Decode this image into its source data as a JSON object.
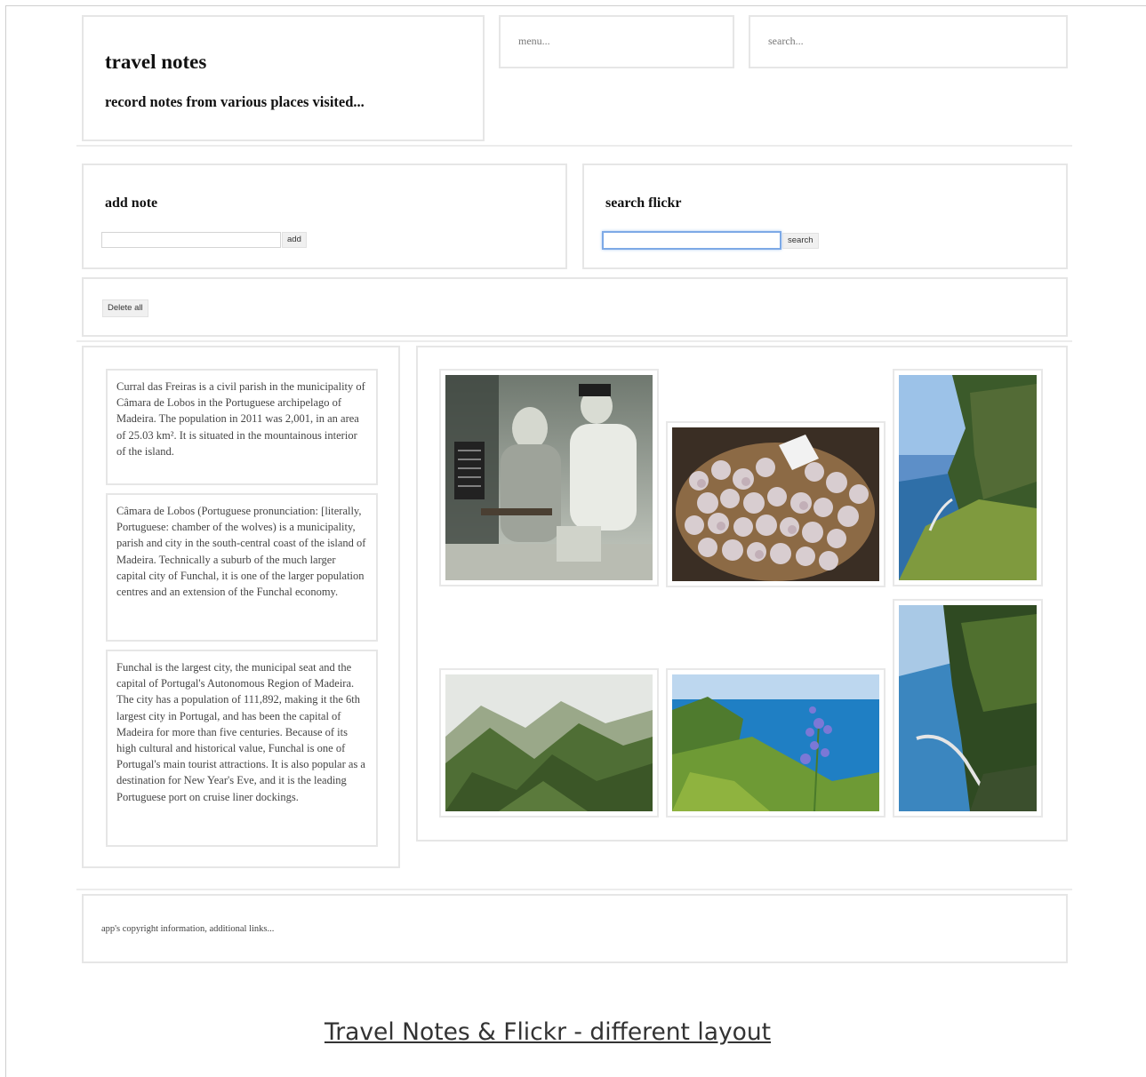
{
  "header": {
    "title": "travel notes",
    "tagline": "record notes from various places visited...",
    "menu_placeholder": "menu...",
    "search_placeholder": "search..."
  },
  "add_note": {
    "title": "add note",
    "input_value": "",
    "button_label": "add"
  },
  "search_flickr": {
    "title": "search flickr",
    "input_value": "",
    "button_label": "search"
  },
  "controls": {
    "delete_all_label": "Delete all"
  },
  "notes": [
    "Curral das Freiras is a civil parish in the municipality of Câmara de Lobos in the Portuguese archipelago of Madeira. The population in 2011 was 2,001, in an area of 25.03 km². It is situated in the mountainous interior of the island.",
    "Câmara de Lobos (Portuguese pronunciation: [literally, Portuguese: chamber of the wolves) is a municipality, parish and city in the south-central coast of the island of Madeira. Technically a suburb of the much larger capital city of Funchal, it is one of the larger population centres and an extension of the Funchal economy.",
    "Funchal is the largest city, the municipal seat and the capital of Portugal's Autonomous Region of Madeira. The city has a population of 111,892, making it the 6th largest city in Portugal, and has been the capital of Madeira for more than five centuries. Because of its high cultural and historical value, Funchal is one of Portugal's main tourist attractions. It is also popular as a destination for New Year's Eve, and it is the leading Portuguese port on cruise liner dockings."
  ],
  "photos": [
    {
      "subject": "accordion-players-photo"
    },
    {
      "subject": "garlic-basket-photo"
    },
    {
      "subject": "coastal-cliff-photo"
    },
    {
      "subject": "green-valley-photo"
    },
    {
      "subject": "agapanthus-sea-photo"
    },
    {
      "subject": "sea-cliff-road-photo"
    }
  ],
  "footer": {
    "text": "app's copyright information, additional links..."
  },
  "caption": "Travel Notes & Flickr - different layout",
  "colors": {
    "border": "#e6e6e6",
    "focus": "#7da9e6",
    "text": "#222222"
  }
}
